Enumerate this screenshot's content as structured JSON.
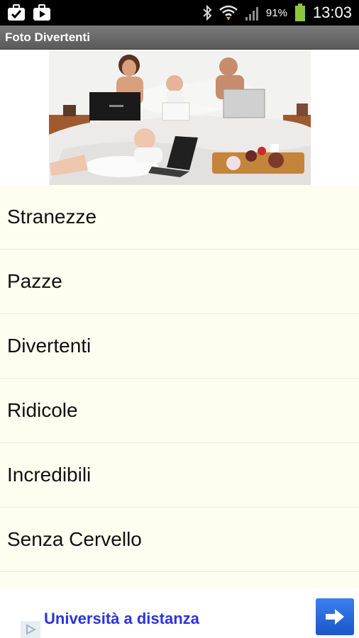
{
  "status_bar": {
    "battery_percent": "91%",
    "time": "13:03",
    "icons": [
      "briefcase-check-icon",
      "play-store-icon",
      "bluetooth-icon",
      "wifi-icon",
      "signal-icon",
      "battery-icon"
    ]
  },
  "app": {
    "title": "Foto Divertenti"
  },
  "banner": {
    "image": "family-in-bed-with-laptops-photo"
  },
  "categories": [
    {
      "label": "Stranezze"
    },
    {
      "label": "Pazze"
    },
    {
      "label": "Divertenti"
    },
    {
      "label": "Ridicole"
    },
    {
      "label": "Incredibili"
    },
    {
      "label": "Senza Cervello"
    }
  ],
  "ad": {
    "text": "Università a distanza",
    "button_icon": "arrow-right-icon",
    "choices_icon": "ad-choices-icon"
  },
  "colors": {
    "list_background": "#fffdf0",
    "title_bar": "#6b6b6b",
    "ad_text": "#2a34d8",
    "ad_button": "#2a6ae0",
    "battery": "#8cc63f"
  }
}
